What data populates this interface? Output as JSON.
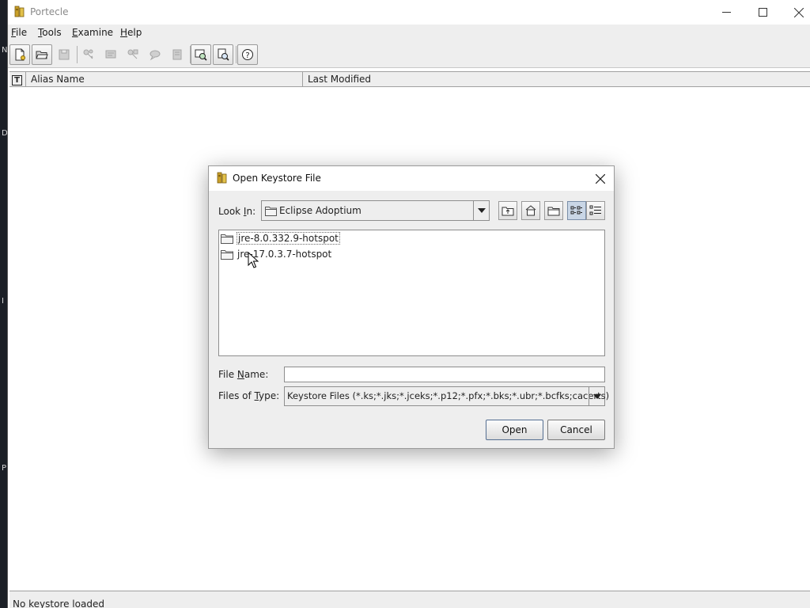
{
  "app": {
    "title": "Portecle",
    "icon": "portecle-app-icon"
  },
  "window_controls": {
    "minimize": "minimize-icon",
    "maximize": "maximize-icon",
    "close": "close-icon"
  },
  "menu": {
    "file": {
      "underline": "F",
      "rest": "ile"
    },
    "tools": {
      "underline": "T",
      "rest": "ools"
    },
    "examine": {
      "underline": "E",
      "rest": "xamine"
    },
    "help": {
      "underline": "H",
      "rest": "elp"
    }
  },
  "toolbar": {
    "buttons": [
      "new-keystore-icon",
      "open-keystore-icon",
      "save-keystore-icon",
      "generate-keypair-icon",
      "import-trusted-cert-icon",
      "import-keypair-icon",
      "set-keystore-password-icon",
      "keystore-report-icon",
      "examine-certificate-icon",
      "examine-crl-icon",
      "help-icon"
    ]
  },
  "table": {
    "type_column": "T",
    "columns": [
      "Alias Name",
      "Last Modified"
    ]
  },
  "status": {
    "text": "No keystore loaded"
  },
  "side_strip": {
    "glyphs": [
      "N",
      "D",
      "I",
      "P"
    ]
  },
  "dialog": {
    "title": "Open Keystore File",
    "look_in": {
      "label_underline": "I",
      "label_before": "Look ",
      "label_after": "n:",
      "value": "Eclipse Adoptium"
    },
    "nav_buttons": [
      "up-one-level-icon",
      "home-icon",
      "new-folder-icon",
      "list-view-icon",
      "details-view-icon"
    ],
    "files": [
      {
        "name": "jre-8.0.332.9-hotspot",
        "selected": true
      },
      {
        "name": "jre-17.0.3.7-hotspot",
        "selected": false
      }
    ],
    "file_name": {
      "label_underline": "N",
      "label_before": "File ",
      "label_after": "ame:",
      "value": ""
    },
    "files_of_type": {
      "label_before": "Files of ",
      "label_underline": "T",
      "label_after": "ype:",
      "value": "Keystore Files (*.ks;*.jks;*.jceks;*.p12;*.pfx;*.bks;*.ubr;*.bcfks;cacerts)"
    },
    "open_label": "Open",
    "cancel_label": "Cancel"
  }
}
